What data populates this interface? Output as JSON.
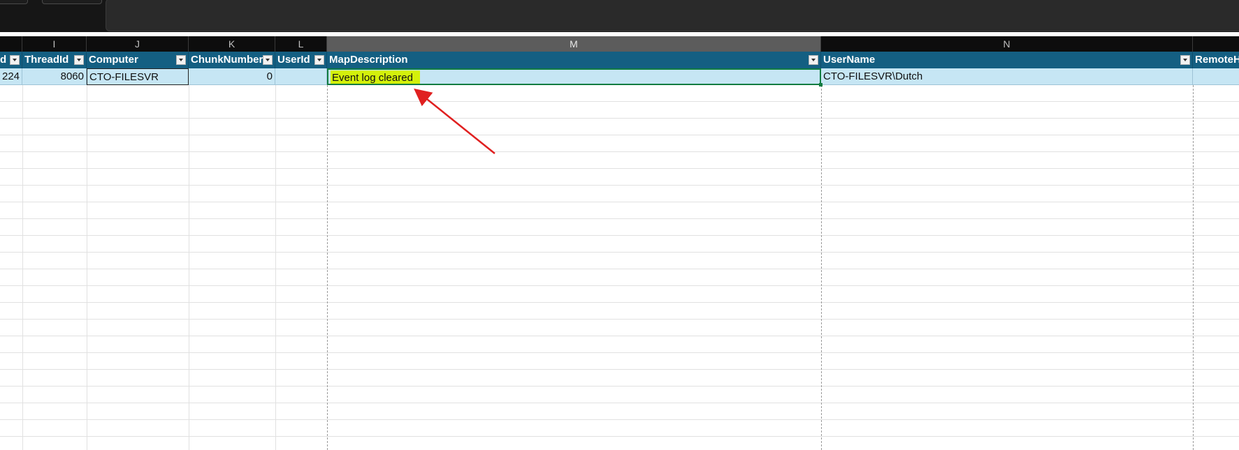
{
  "column_letters": [
    "I",
    "J",
    "K",
    "L",
    "M",
    "N"
  ],
  "table": {
    "headers": [
      "d",
      "ThreadId",
      "Computer",
      "ChunkNumber",
      "UserId",
      "MapDescription",
      "UserName",
      "RemoteH"
    ],
    "row": {
      "partial": "224",
      "thread_id": "8060",
      "computer": "CTO-FILESVR",
      "chunk_number": "0",
      "user_id": "",
      "map_description": "Event log cleared",
      "user_name": "CTO-FILESVR\\Dutch",
      "remote": ""
    }
  },
  "selected_column": "M",
  "colors": {
    "table_header": "#145f82",
    "row_highlight": "#c6e6f4",
    "text_highlight": "#d4f00a",
    "arrow": "#e02020",
    "selected_column_header": "#5c5c5c"
  }
}
